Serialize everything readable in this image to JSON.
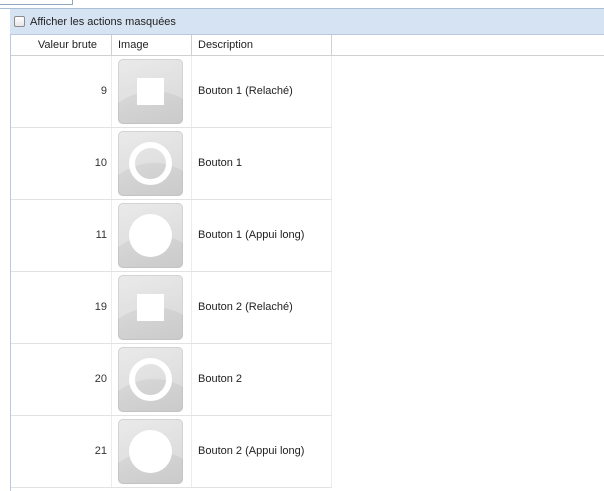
{
  "filter": {
    "label": "Afficher les actions masquées",
    "checked": false
  },
  "columns": {
    "value": "Valeur brute",
    "image": "Image",
    "description": "Description"
  },
  "rows": [
    {
      "value": "9",
      "icon": "square-icon",
      "description": "Bouton 1 (Relaché)"
    },
    {
      "value": "10",
      "icon": "ring-icon",
      "description": "Bouton 1"
    },
    {
      "value": "11",
      "icon": "filled-circle-icon",
      "description": "Bouton 1 (Appui long)"
    },
    {
      "value": "19",
      "icon": "square-icon",
      "description": "Bouton 2 (Relaché)"
    },
    {
      "value": "20",
      "icon": "ring-icon",
      "description": "Bouton 2"
    },
    {
      "value": "21",
      "icon": "filled-circle-icon",
      "description": "Bouton 2 (Appui long)"
    }
  ]
}
